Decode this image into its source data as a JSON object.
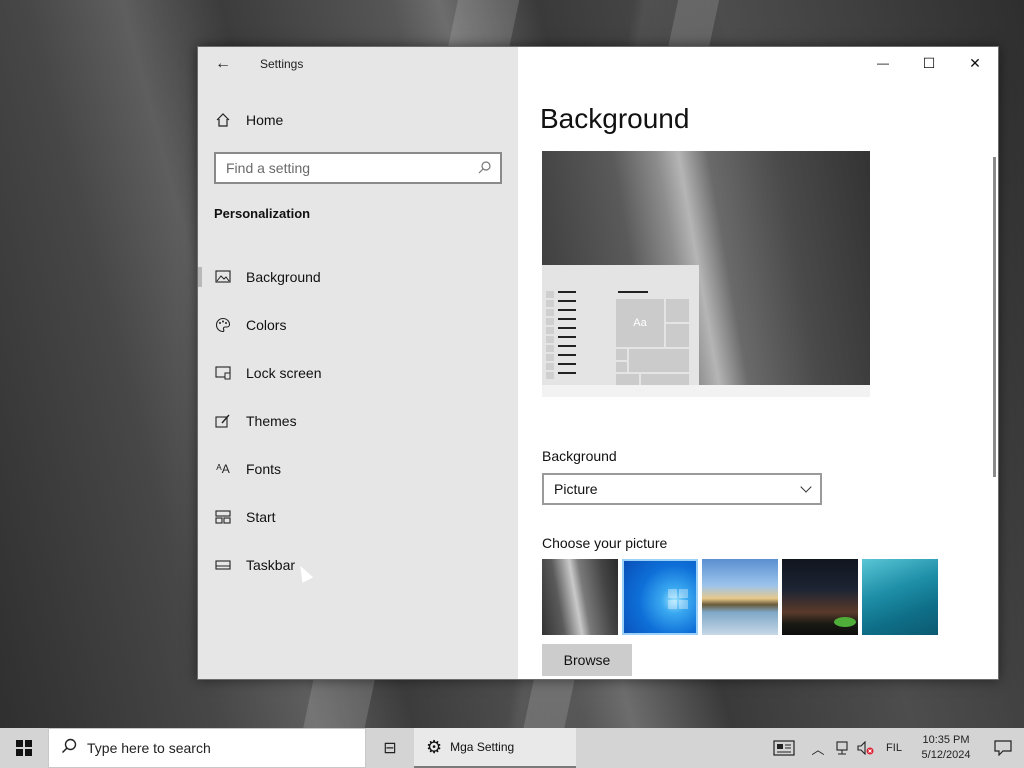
{
  "window": {
    "app_title": "Settings",
    "home_label": "Home",
    "search_placeholder": "Find a setting",
    "section_title": "Personalization",
    "nav_items": [
      {
        "label": "Background",
        "icon": "picture-icon",
        "active": true
      },
      {
        "label": "Colors",
        "icon": "palette-icon"
      },
      {
        "label": "Lock screen",
        "icon": "lock-screen-icon"
      },
      {
        "label": "Themes",
        "icon": "brush-icon"
      },
      {
        "label": "Fonts",
        "icon": "fonts-icon"
      },
      {
        "label": "Start",
        "icon": "start-icon"
      },
      {
        "label": "Taskbar",
        "icon": "taskbar-icon"
      }
    ],
    "controls": {
      "minimize": "—",
      "maximize": "☐",
      "close": "✕"
    }
  },
  "main": {
    "page_title": "Background",
    "preview_tile_text": "Aa",
    "background_label": "Background",
    "background_value": "Picture",
    "choose_label": "Choose your picture",
    "browse_label": "Browse",
    "thumbnails": [
      "rock-wall",
      "windows-blue",
      "beach-rocks",
      "night-sky",
      "underwater-swimmer"
    ]
  },
  "taskbar": {
    "search_text": "Type here to search",
    "app_label": "Mga Setting",
    "lang": "FIL",
    "time": "10:35 PM",
    "date": "5/12/2024"
  },
  "colors": {
    "sidebar_bg": "#e6e6e6",
    "taskbar_bg": "#d4d4d4",
    "accent_selected": "#9bd0f7"
  }
}
